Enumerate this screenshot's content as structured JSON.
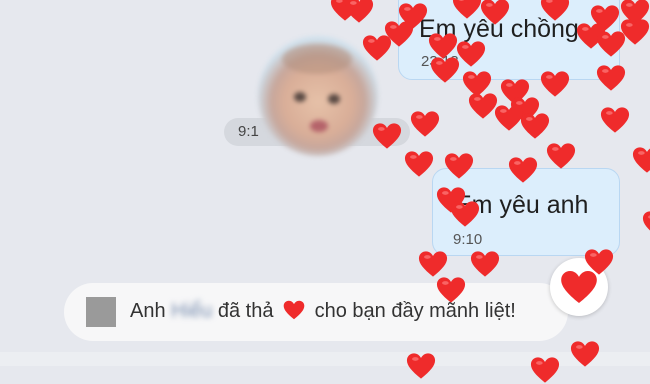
{
  "messages": [
    {
      "text": "Em yêu chồng",
      "time": "23:18"
    },
    {
      "text": "Em yêu anh",
      "time": "9:10"
    }
  ],
  "time_pill": {
    "text": "9:1"
  },
  "notice": {
    "prefix": "Anh",
    "blurred_name": "Hiểu",
    "middle": "đã thả",
    "suffix": "cho bạn đầy mãnh liệt!"
  },
  "icons": {
    "heart": "heart-icon",
    "avatar": "avatar-photo",
    "notice_avatar": "placeholder-square"
  },
  "colors": {
    "heart": "#ef2b2b",
    "bubble": "#dceefc",
    "background": "#e6e8ee"
  }
}
